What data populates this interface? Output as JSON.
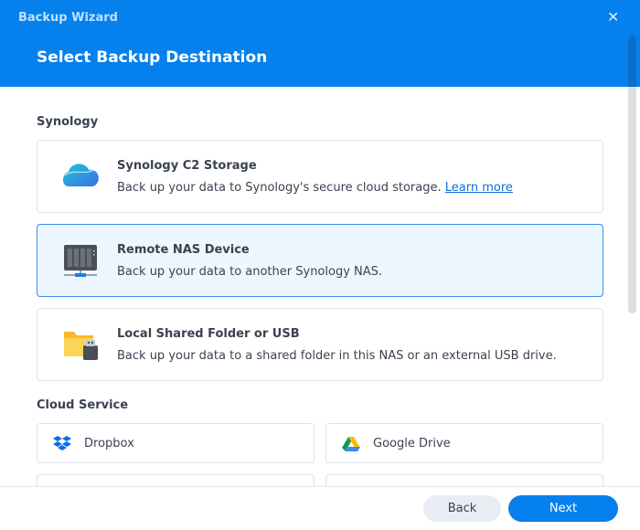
{
  "window": {
    "title": "Backup Wizard",
    "page_title": "Select Backup Destination"
  },
  "sections": {
    "synology": {
      "label": "Synology",
      "items": [
        {
          "title": "Synology C2 Storage",
          "desc": "Back up your data to Synology's secure cloud storage.",
          "link": "Learn more",
          "icon": "cloud-icon"
        },
        {
          "title": "Remote NAS Device",
          "desc": "Back up your data to another Synology NAS.",
          "icon": "nas-icon",
          "selected": true
        },
        {
          "title": "Local Shared Folder or USB",
          "desc": "Back up your data to a shared folder in this NAS or an external USB drive.",
          "icon": "folder-usb-icon"
        }
      ]
    },
    "cloud": {
      "label": "Cloud Service",
      "items": [
        {
          "label": "Dropbox",
          "icon": "dropbox-icon"
        },
        {
          "label": "Google Drive",
          "icon": "google-drive-icon"
        }
      ]
    }
  },
  "footer": {
    "back": "Back",
    "next": "Next"
  },
  "colors": {
    "accent": "#0580ec",
    "selected_bg": "#eef6ff"
  }
}
